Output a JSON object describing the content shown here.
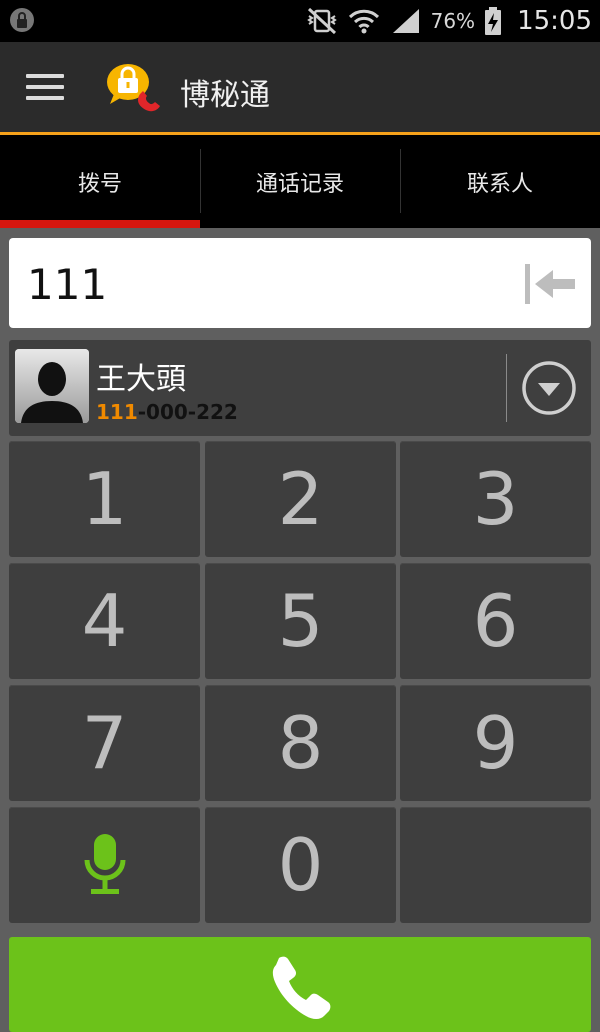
{
  "status_bar": {
    "battery_percent": "76%",
    "time": "15:05",
    "icons": [
      "mute-vibrate-icon",
      "wifi-icon",
      "signal-icon",
      "battery-charging-icon"
    ]
  },
  "app_bar": {
    "title": "博秘通",
    "menu_icon": "hamburger-menu-icon",
    "logo_icon": "lock-phone-logo-icon"
  },
  "tabs": [
    {
      "label": "拨号",
      "active": true
    },
    {
      "label": "通话记录",
      "active": false
    },
    {
      "label": "联系人",
      "active": false
    }
  ],
  "dialer": {
    "number_value": "111",
    "backspace_icon": "backspace-icon"
  },
  "contact_match": {
    "name": "王大頭",
    "number_highlight": "111",
    "number_rest": "-000-222",
    "avatar_icon": "person-silhouette-icon",
    "expand_icon": "chevron-down-circle-icon"
  },
  "keypad": {
    "keys": [
      "1",
      "2",
      "3",
      "4",
      "5",
      "6",
      "7",
      "8",
      "9",
      "",
      "0",
      ""
    ],
    "voice_icon": "microphone-icon"
  },
  "call_button": {
    "icon": "phone-icon"
  },
  "colors": {
    "accent_orange": "#f7a21a",
    "tab_indicator": "#d6160f",
    "call_green": "#6cc21a",
    "match_highlight": "#f08a00",
    "mic_green": "#6cc21a"
  }
}
